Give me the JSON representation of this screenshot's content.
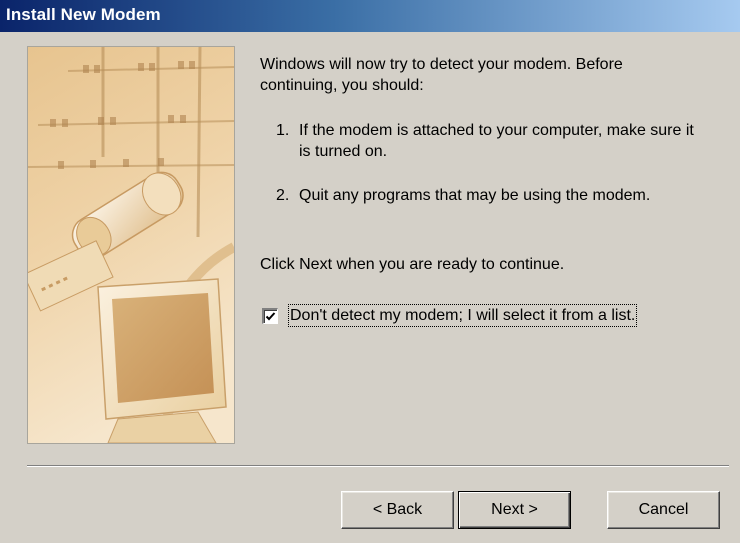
{
  "window": {
    "title": "Install New Modem"
  },
  "content": {
    "intro": "Windows will now try to detect your modem.  Before continuing, you should:",
    "steps": [
      {
        "number": "1.",
        "text": "If the modem is attached to your computer, make sure it is turned on."
      },
      {
        "number": "2.",
        "text": "Quit any programs that may be using the modem."
      }
    ],
    "ready": "Click Next when you are ready to continue.",
    "checkbox": {
      "label": "Don't detect my modem; I will select it from a list.",
      "checked": true
    }
  },
  "buttons": {
    "back": "< Back",
    "next": "Next >",
    "cancel": "Cancel"
  },
  "colors": {
    "face": "#d4d0c8",
    "title_start": "#0a246a",
    "title_end": "#a6caf0",
    "image_tone": "#e8c896"
  },
  "image": {
    "icon": "wizard-modem-illustration"
  }
}
